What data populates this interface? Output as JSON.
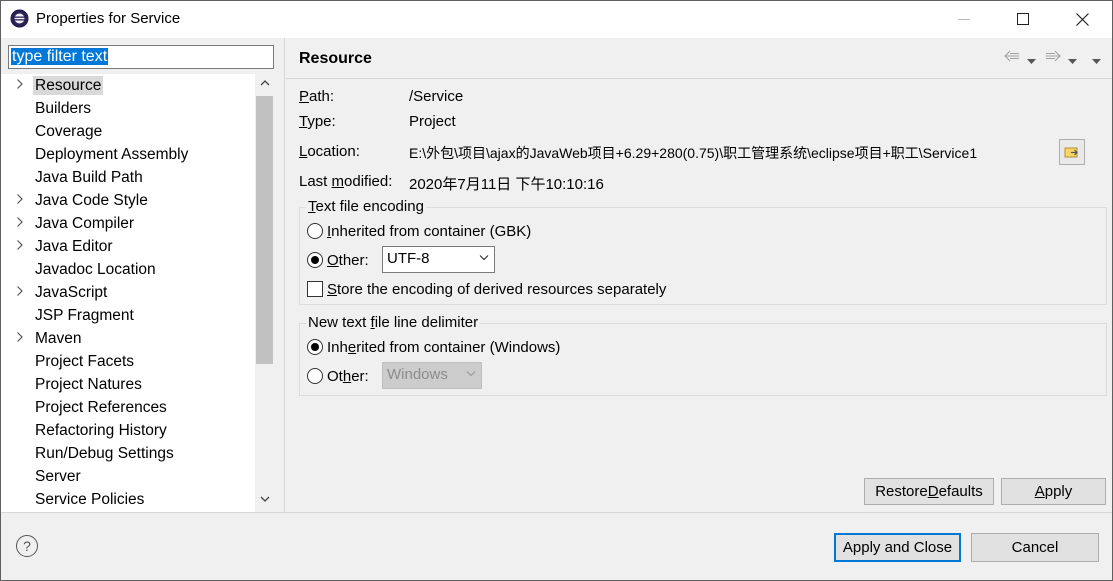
{
  "window": {
    "title": "Properties for Service"
  },
  "filter": {
    "placeholder": "type filter text"
  },
  "tree": {
    "items": [
      {
        "label": "Resource",
        "expandable": true,
        "selected": true
      },
      {
        "label": "Builders",
        "expandable": false
      },
      {
        "label": "Coverage",
        "expandable": false
      },
      {
        "label": "Deployment Assembly",
        "expandable": false
      },
      {
        "label": "Java Build Path",
        "expandable": false
      },
      {
        "label": "Java Code Style",
        "expandable": true
      },
      {
        "label": "Java Compiler",
        "expandable": true
      },
      {
        "label": "Java Editor",
        "expandable": true
      },
      {
        "label": "Javadoc Location",
        "expandable": false
      },
      {
        "label": "JavaScript",
        "expandable": true
      },
      {
        "label": "JSP Fragment",
        "expandable": false
      },
      {
        "label": "Maven",
        "expandable": true
      },
      {
        "label": "Project Facets",
        "expandable": false
      },
      {
        "label": "Project Natures",
        "expandable": false
      },
      {
        "label": "Project References",
        "expandable": false
      },
      {
        "label": "Refactoring History",
        "expandable": false
      },
      {
        "label": "Run/Debug Settings",
        "expandable": false
      },
      {
        "label": "Server",
        "expandable": false
      },
      {
        "label": "Service Policies",
        "expandable": false
      }
    ]
  },
  "page": {
    "heading": "Resource",
    "path_label_u": "P",
    "path_label_rest": "ath:",
    "path_value": "/Service",
    "type_label_u": "T",
    "type_label_rest": "ype:",
    "type_value": "Project",
    "location_label_u": "L",
    "location_label_rest": "ocation:",
    "location_value": "E:\\外包\\项目\\ajax的JavaWeb项目+6.29+280(0.75)\\职工管理系统\\eclipse项目+职工\\Service1",
    "modified_label_pre": "Last ",
    "modified_label_u": "m",
    "modified_label_rest": "odified:",
    "modified_value": "2020年7月11日 下午10:10:16"
  },
  "encoding": {
    "group_title_u": "T",
    "group_title_rest": "ext file encoding",
    "inherited_u": "I",
    "inherited_rest": "nherited from container (GBK)",
    "other_u": "O",
    "other_rest": "ther:",
    "other_value": "UTF-8",
    "store_u": "S",
    "store_rest": "tore the encoding of derived resources separately",
    "selected": "other",
    "store_checked": false
  },
  "delimiter": {
    "group_title_pre": "New text ",
    "group_title_u": "f",
    "group_title_rest": "ile line delimiter",
    "inherited_pre": "Inh",
    "inherited_u": "e",
    "inherited_rest": "rited from container (Windows)",
    "other_pre": "Ot",
    "other_u": "h",
    "other_rest": "er:",
    "other_value": "Windows",
    "selected": "inherited"
  },
  "buttons": {
    "restore_pre": "Restore ",
    "restore_u": "D",
    "restore_rest": "efaults",
    "apply_u": "A",
    "apply_rest": "pply",
    "apply_close": "Apply and Close",
    "cancel": "Cancel"
  },
  "icons": {
    "back": "back-arrow-icon",
    "forward": "forward-arrow-icon",
    "menu": "view-menu-icon",
    "help": "help-icon",
    "browse": "open-folder-icon"
  },
  "colors": {
    "selection": "#0078d7",
    "tree_selected": "#d9d9d9",
    "background": "#f0f0f0"
  }
}
